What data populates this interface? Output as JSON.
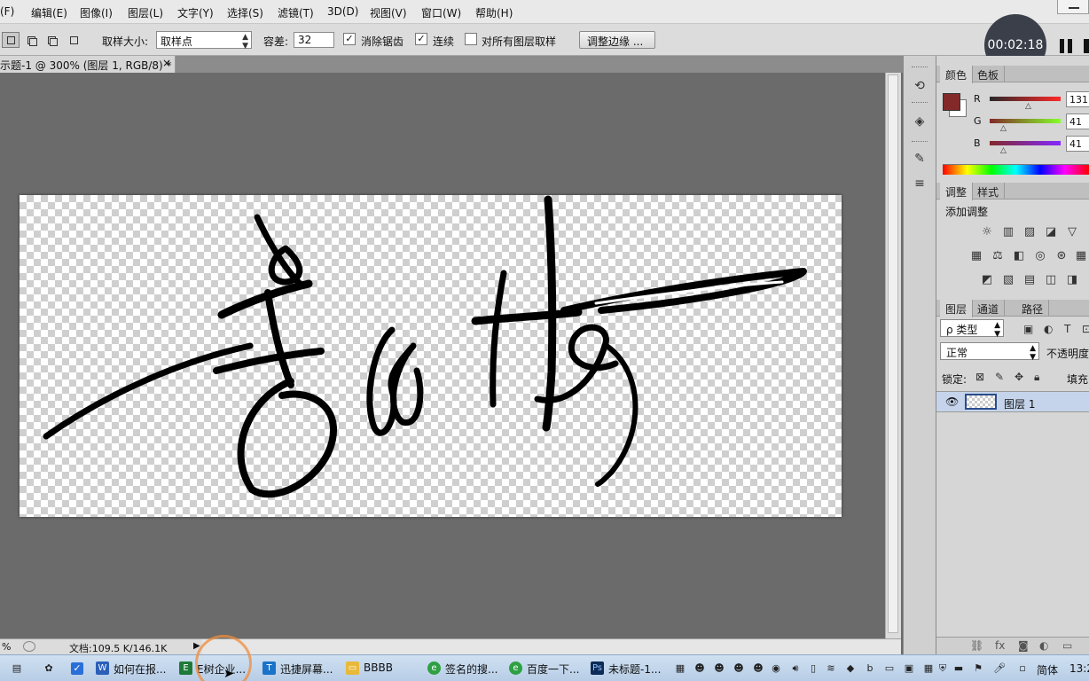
{
  "menu": {
    "items": [
      "(F)",
      "编辑(E)",
      "图像(I)",
      "图层(L)",
      "文字(Y)",
      "选择(S)",
      "滤镜(T)",
      "3D(D)",
      "视图(V)",
      "窗口(W)",
      "帮助(H)"
    ]
  },
  "options": {
    "sample_size_label": "取样大小:",
    "sample_size_value": "取样点",
    "tolerance_label": "容差:",
    "tolerance_value": "32",
    "antialias_label": "消除锯齿",
    "antialias_checked": "✓",
    "contiguous_label": "连续",
    "contiguous_checked": "✓",
    "all_layers_label": "对所有图层取样",
    "refine_edge_label": "调整边缘 ..."
  },
  "recorder": {
    "elapsed": "00:02:18"
  },
  "document": {
    "tab_title": "示题-1 @ 300% (图层 1, RGB/8) *",
    "close_glyph": "×"
  },
  "status": {
    "zoom": "%",
    "doc_size": "文档:109.5 K/146.1K",
    "arrow": "▶"
  },
  "color_panel": {
    "tabs": [
      "颜色",
      "色板"
    ],
    "foreground": "#832929",
    "r_label": "R",
    "r_value": "131",
    "g_label": "G",
    "g_value": "41",
    "b_label": "B",
    "b_value": "41"
  },
  "adjust_panel": {
    "tabs": [
      "调整",
      "样式"
    ],
    "heading": "添加调整",
    "icons": [
      "brightness-icon",
      "levels-icon",
      "curves-icon",
      "exposure-icon",
      "vibrance-icon",
      "hue-saturation-icon",
      "color-balance-icon",
      "black-white-icon",
      "photo-filter-icon",
      "channel-mixer-icon",
      "color-lookup-icon",
      "invert-icon",
      "posterize-icon",
      "threshold-icon",
      "gradient-map-icon",
      "selective-color-icon"
    ]
  },
  "layers_panel": {
    "tabs": [
      "图层",
      "通道",
      "路径"
    ],
    "filter_label": "ρ 类型",
    "blend_mode": "正常",
    "opacity_label": "不透明度",
    "lock_label": "锁定:",
    "fill_label": "填充",
    "layer_name": "图层 1"
  },
  "taskbar": {
    "items": [
      "如何在报...",
      "E树企业...",
      "迅捷屏幕...",
      "BBBB",
      "签名的搜...",
      "百度一下...",
      "未标题-1..."
    ],
    "ime": "简体",
    "clock": "13:2"
  }
}
